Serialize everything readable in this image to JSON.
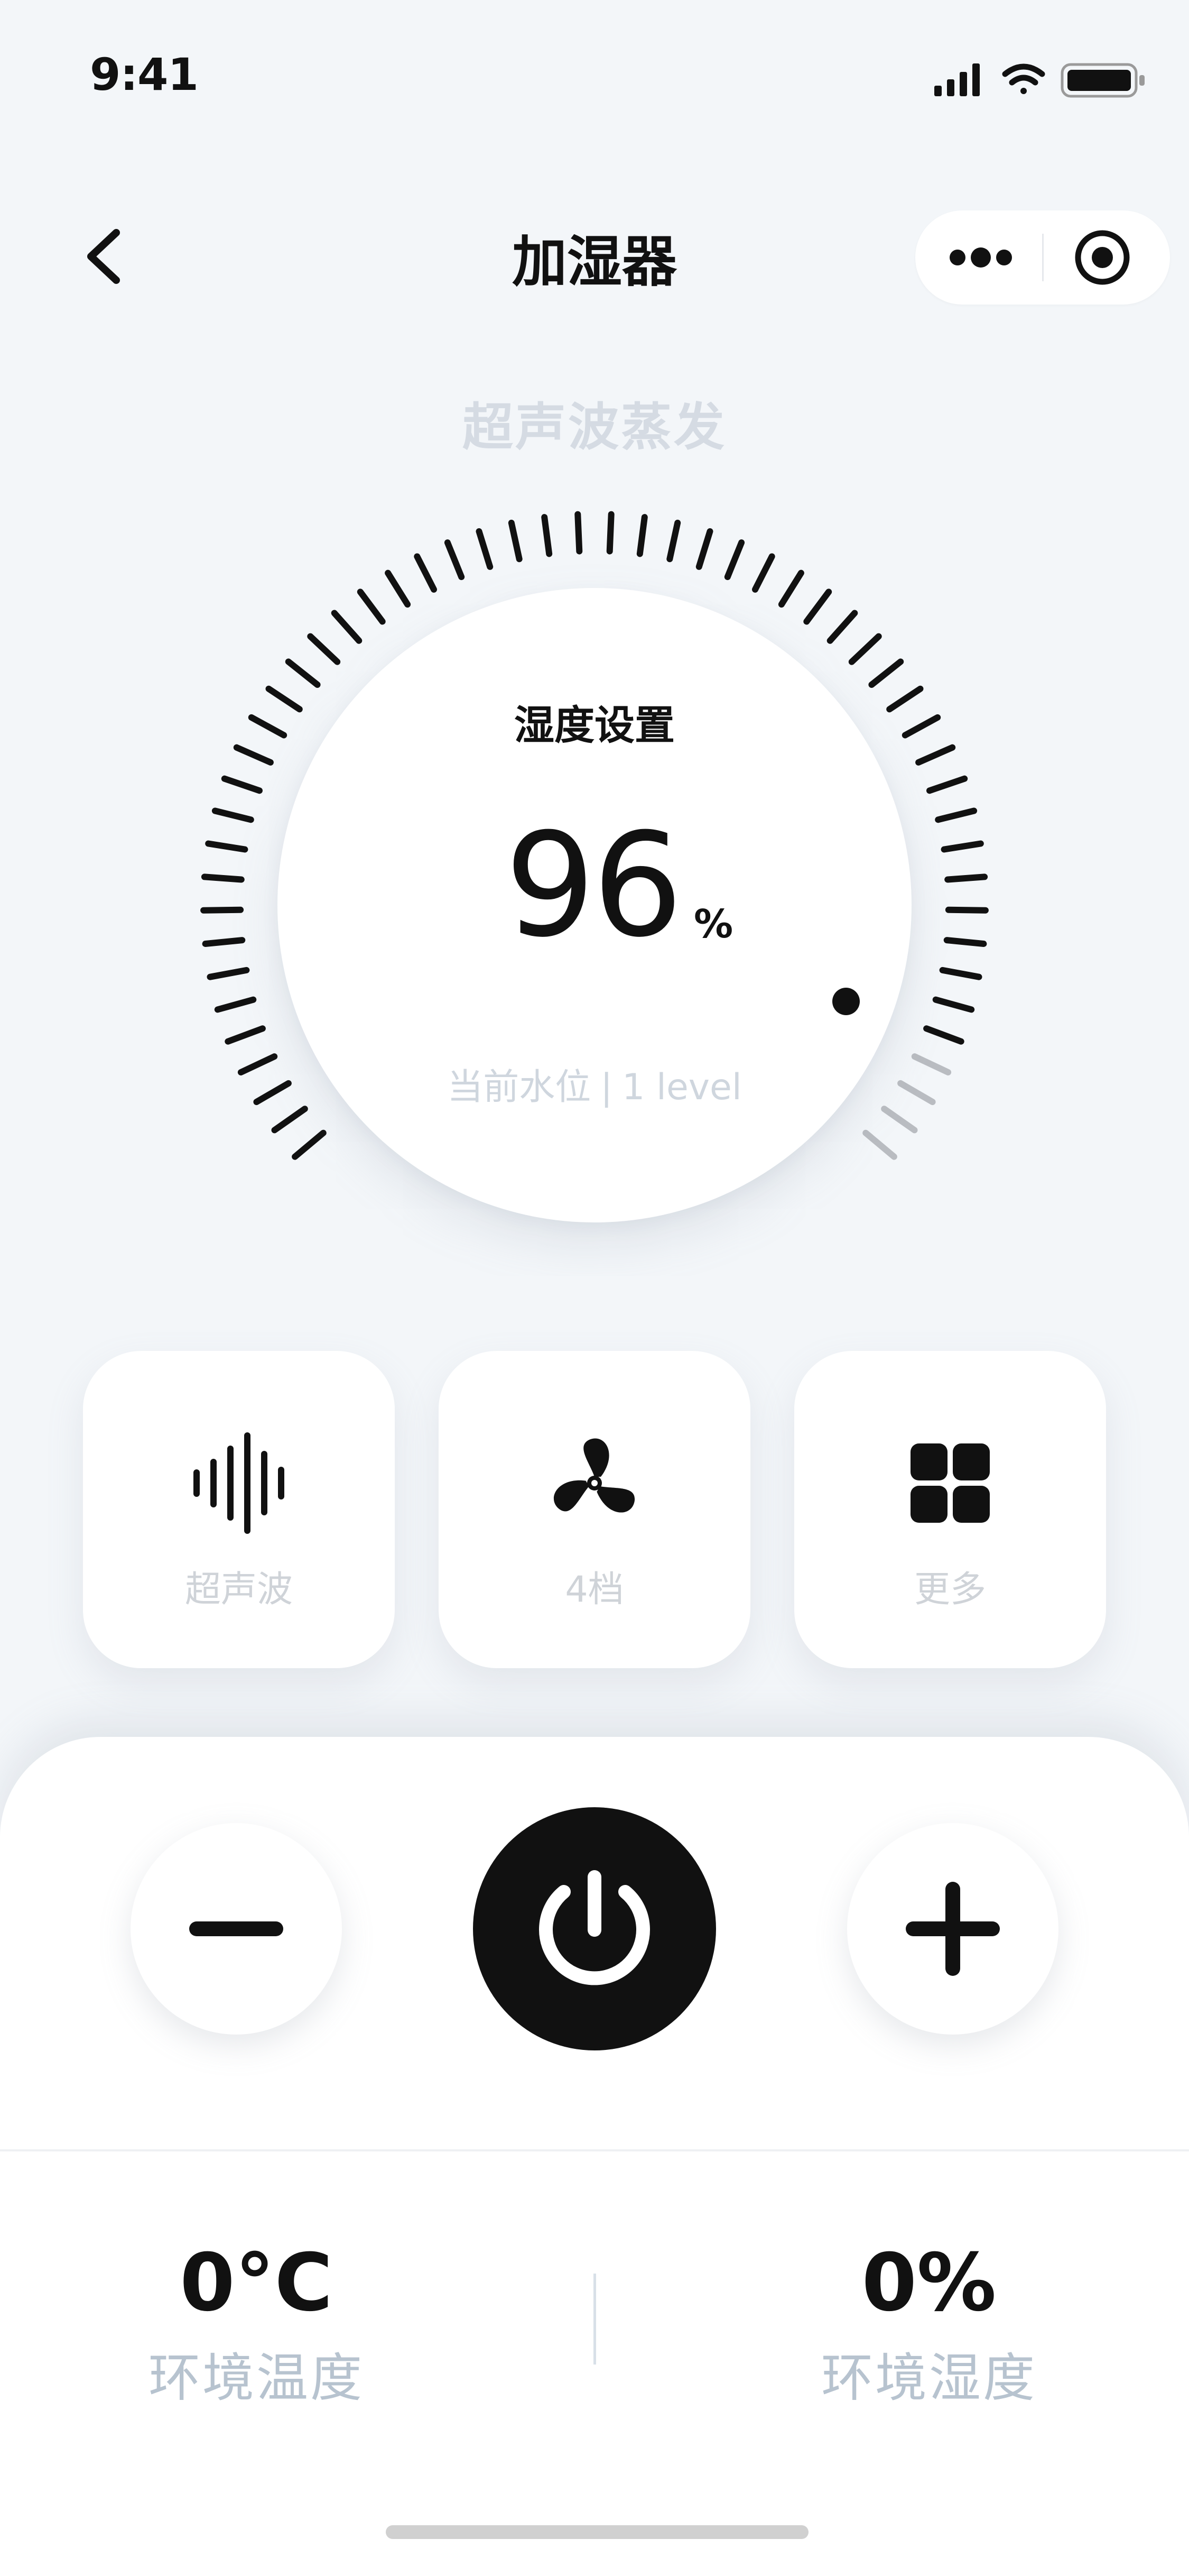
{
  "status_bar": {
    "time": "9:41"
  },
  "nav": {
    "title": "加湿器"
  },
  "mode_label": "超声波蒸发",
  "dial": {
    "title": "湿度设置",
    "humidity_value": "96",
    "humidity_unit": "%",
    "water_level_label": "当前水位",
    "water_level_separator": "|",
    "water_level_value": "1 level"
  },
  "cards": [
    {
      "label": "超声波",
      "icon": "sound-wave-icon"
    },
    {
      "label": "4档",
      "icon": "fan-icon"
    },
    {
      "label": "更多",
      "icon": "grid-icon"
    }
  ],
  "controls": {
    "minus_icon": "minus-icon",
    "power_icon": "power-icon",
    "plus_icon": "plus-icon"
  },
  "stats": {
    "temperature": {
      "value": "0°C",
      "label": "环境温度"
    },
    "humidity": {
      "value": "0%",
      "label": "环境湿度"
    }
  },
  "colors": {
    "background": "#f3f6f9",
    "accent": "#111111",
    "muted_text": "#cfd6de",
    "active_tick": "#111111",
    "inactive_tick": "#b9bcc1"
  }
}
